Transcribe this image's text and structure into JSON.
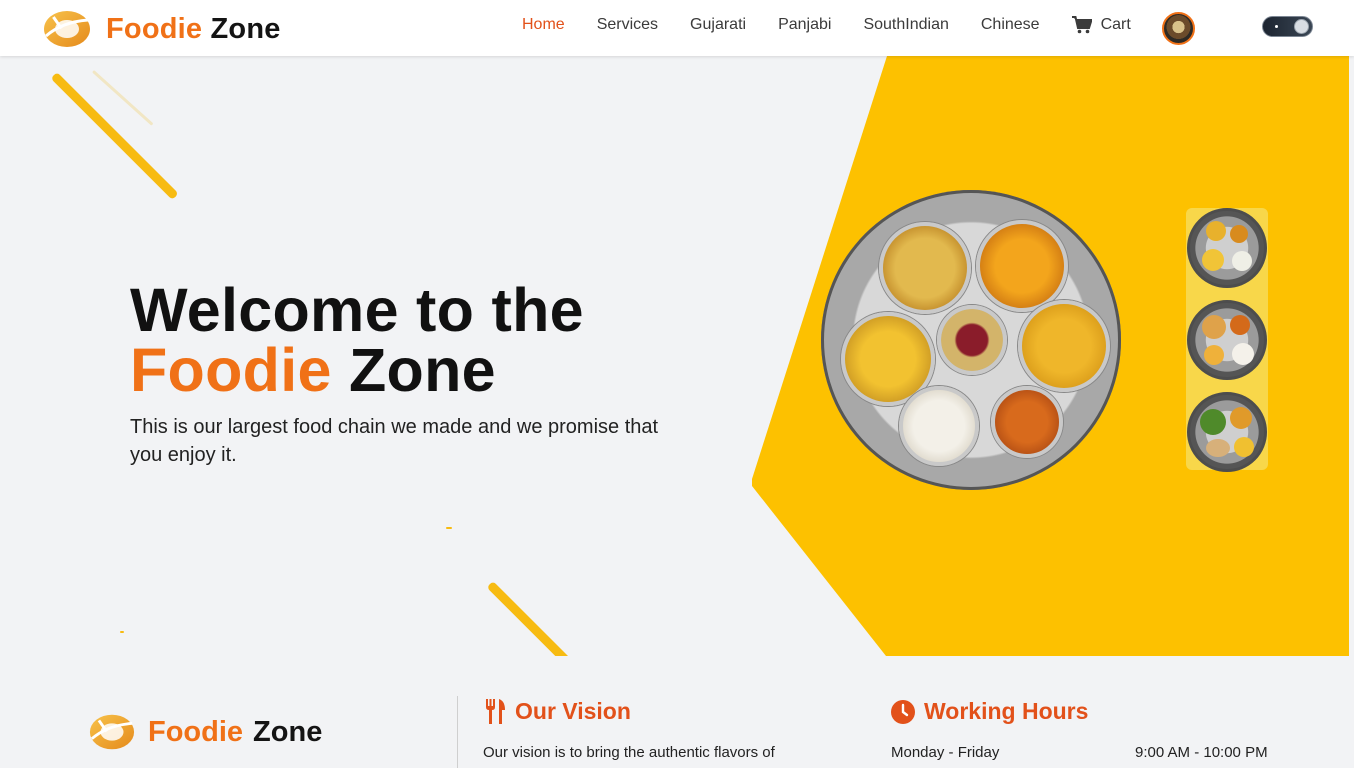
{
  "brand": {
    "name_first": "Foodie",
    "name_second": "Zone"
  },
  "nav": {
    "items": [
      {
        "label": "Home",
        "active": true
      },
      {
        "label": "Services",
        "active": false
      },
      {
        "label": "Gujarati",
        "active": false
      },
      {
        "label": "Panjabi",
        "active": false
      },
      {
        "label": "SouthIndian",
        "active": false
      },
      {
        "label": "Chinese",
        "active": false
      }
    ],
    "cart_label": "Cart",
    "cart_icon": "cart-icon",
    "profile_icon": "avatar",
    "theme_toggle_icon": "moon-toggle-icon"
  },
  "hero": {
    "title_line1": "Welcome to the",
    "title_highlight": "Foodie",
    "title_rest": "Zone",
    "subtitle": "This is our largest food chain we made and we promise that you enjoy it."
  },
  "footer": {
    "brand_first": "Foodie",
    "brand_second": "Zone",
    "vision": {
      "heading": "Our Vision",
      "icon": "utensils-icon",
      "text": "Our vision is to bring the authentic flavors of"
    },
    "hours": {
      "heading": "Working Hours",
      "icon": "clock-icon",
      "day": "Monday - Friday",
      "time": "9:00 AM - 10:00 PM"
    }
  },
  "colors": {
    "accent": "#f07117",
    "accent_dark": "#e2511a",
    "panel_yellow": "#fdc100",
    "background": "#f2f3f5"
  }
}
